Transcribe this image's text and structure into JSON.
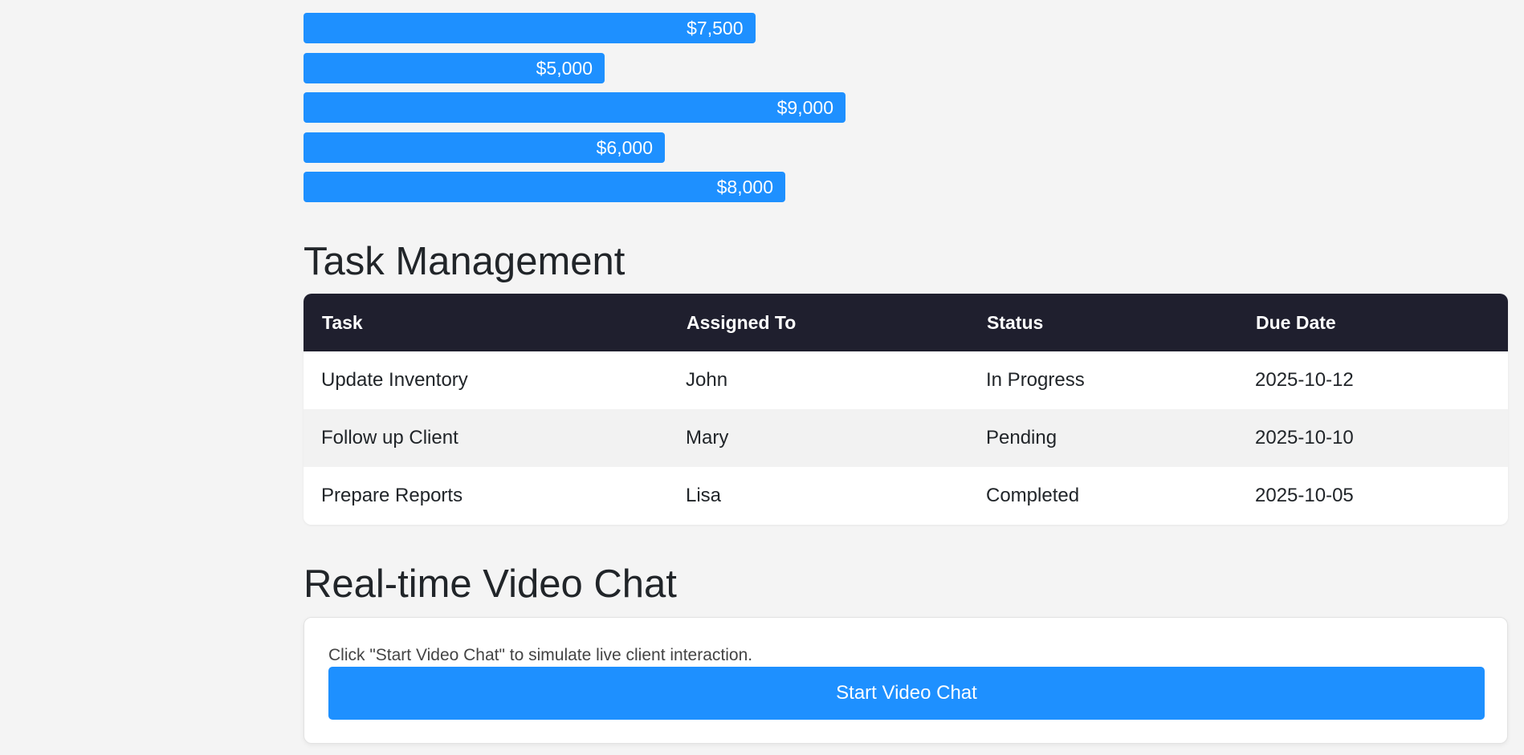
{
  "chart_data": {
    "type": "bar",
    "orientation": "horizontal",
    "title": "",
    "values": [
      7500,
      5000,
      9000,
      6000,
      8000
    ],
    "value_labels": [
      "$7,500",
      "$5,000",
      "$9,000",
      "$6,000",
      "$8,000"
    ],
    "bar_color": "#1e90ff"
  },
  "tasks": {
    "title": "Task Management",
    "columns": [
      "Task",
      "Assigned To",
      "Status",
      "Due Date"
    ],
    "rows": [
      [
        "Update Inventory",
        "John",
        "In Progress",
        "2025-10-12"
      ],
      [
        "Follow up Client",
        "Mary",
        "Pending",
        "2025-10-10"
      ],
      [
        "Prepare Reports",
        "Lisa",
        "Completed",
        "2025-10-05"
      ]
    ]
  },
  "video_chat": {
    "title": "Real-time Video Chat",
    "hint": "Click \"Start Video Chat\" to simulate live client interaction.",
    "button_label": "Start Video Chat"
  },
  "colors": {
    "accent": "#1e90ff",
    "table_header": "#1f1f2e",
    "page_background": "#f4f4f4"
  }
}
